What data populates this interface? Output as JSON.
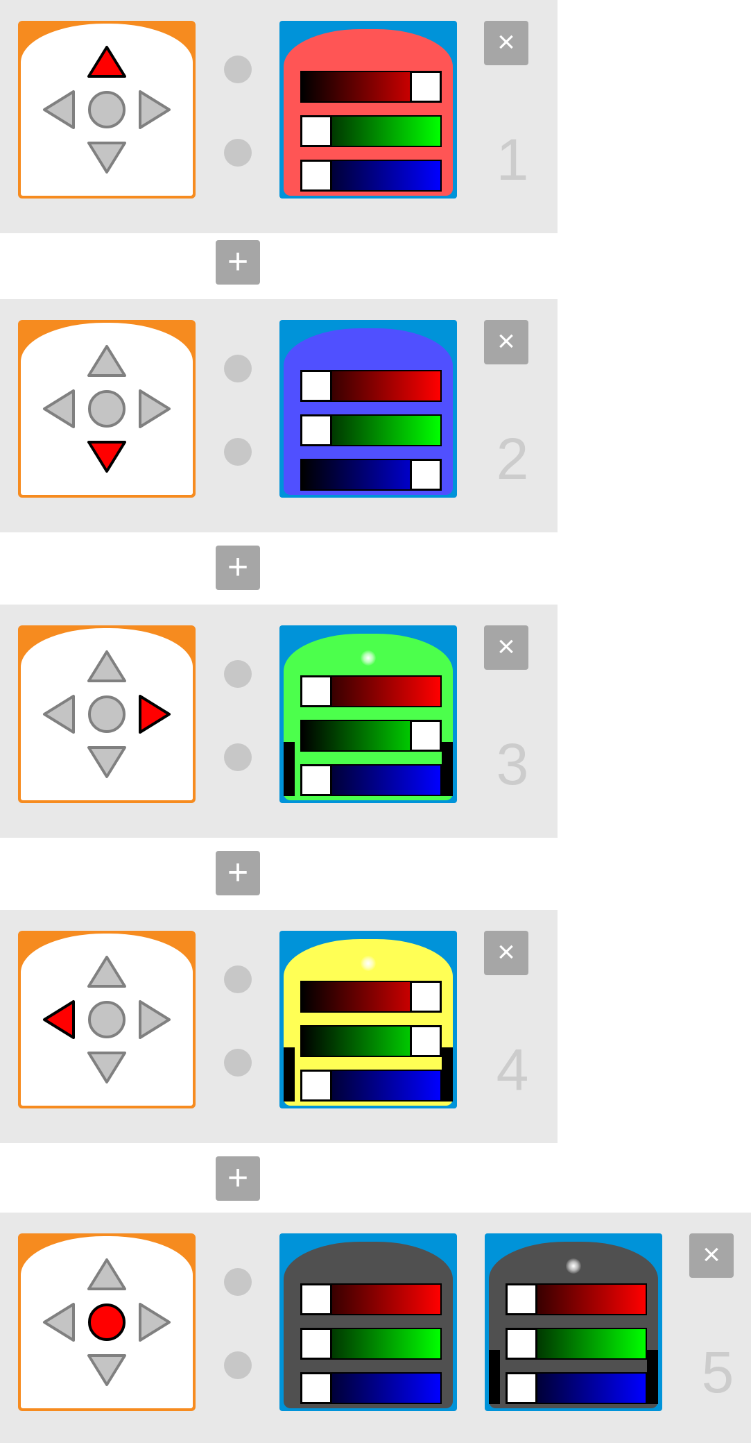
{
  "rows": [
    {
      "number": "1",
      "pressed": "up",
      "actions": [
        {
          "robot_color": "#ff5555",
          "red": 1.0,
          "green": 0.0,
          "blue": 0.0,
          "glow": false,
          "wheels": false
        }
      ]
    },
    {
      "number": "2",
      "pressed": "down",
      "actions": [
        {
          "robot_color": "#5050ff",
          "red": 0.0,
          "green": 0.0,
          "blue": 1.0,
          "glow": false,
          "wheels": false
        }
      ]
    },
    {
      "number": "3",
      "pressed": "right",
      "actions": [
        {
          "robot_color": "#4cff4c",
          "red": 0.0,
          "green": 1.0,
          "blue": 0.0,
          "glow": true,
          "wheels": true
        }
      ]
    },
    {
      "number": "4",
      "pressed": "left",
      "actions": [
        {
          "robot_color": "#ffff55",
          "red": 1.0,
          "green": 1.0,
          "blue": 0.0,
          "glow": true,
          "wheels": true
        }
      ]
    },
    {
      "number": "5",
      "pressed": "center",
      "actions": [
        {
          "robot_color": "#505050",
          "red": 0.0,
          "green": 0.0,
          "blue": 0.0,
          "glow": false,
          "wheels": false
        },
        {
          "robot_color": "#505050",
          "red": 0.0,
          "green": 0.0,
          "blue": 0.0,
          "glow": true,
          "wheels": true
        }
      ]
    }
  ],
  "close_label": "×",
  "add_label": "+",
  "colors": {
    "row_bg": "#e8e8e8",
    "event_orange": "#f68b1f",
    "action_blue": "#0093d9",
    "button_gray": "#a6a6a6",
    "pressed_red": "#ff0000",
    "idle_gray": "#c4c4c4",
    "number_gray": "#cccccc"
  }
}
